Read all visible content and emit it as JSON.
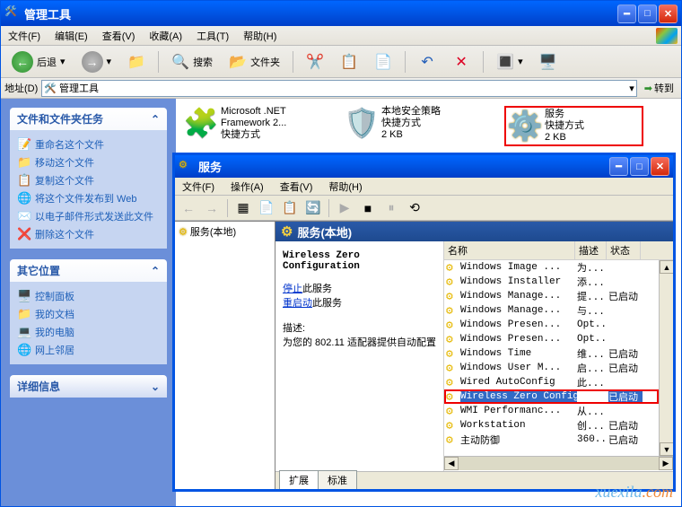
{
  "parent": {
    "title": "管理工具",
    "menus": [
      "文件(F)",
      "编辑(E)",
      "查看(V)",
      "收藏(A)",
      "工具(T)",
      "帮助(H)"
    ],
    "back": "后退",
    "search": "搜索",
    "folders": "文件夹",
    "addr_label": "地址(D)",
    "addr_value": "管理工具",
    "go": "转到"
  },
  "tasks": {
    "g1": {
      "title": "文件和文件夹任务"
    },
    "links1": [
      "重命名这个文件",
      "移动这个文件",
      "复制这个文件",
      "将这个文件发布到 Web",
      "以电子邮件形式发送此文件",
      "删除这个文件"
    ],
    "g2": {
      "title": "其它位置"
    },
    "links2": [
      "控制面板",
      "我的文档",
      "我的电脑",
      "网上邻居"
    ],
    "g3": {
      "title": "详细信息"
    }
  },
  "items": [
    {
      "name": "Microsoft .NET",
      "line2": "Framework 2...",
      "line3": "快捷方式"
    },
    {
      "name": "本地安全策略",
      "line2": "快捷方式",
      "line3": "2 KB"
    },
    {
      "name": "服务",
      "line2": "快捷方式",
      "line3": "2 KB"
    }
  ],
  "services": {
    "title": "服务",
    "menus": [
      "文件(F)",
      "操作(A)",
      "查看(V)",
      "帮助(H)"
    ],
    "tree_label": "服务(本地)",
    "header": "服务(本地)",
    "sel_name": "Wireless Zero Configuration",
    "stop": "停止",
    "stop_suffix": "此服务",
    "restart": "重启动",
    "restart_suffix": "此服务",
    "desc_label": "描述:",
    "desc_text": "为您的 802.11 适配器提供自动配置",
    "cols": {
      "name": "名称",
      "desc": "描述",
      "status": "状态"
    },
    "rows": [
      {
        "n": "Windows Image ...",
        "d": "为...",
        "s": ""
      },
      {
        "n": "Windows Installer",
        "d": "添...",
        "s": ""
      },
      {
        "n": "Windows Manage...",
        "d": "提...",
        "s": "已启动"
      },
      {
        "n": "Windows Manage...",
        "d": "与...",
        "s": ""
      },
      {
        "n": "Windows Presen...",
        "d": "Opt...",
        "s": ""
      },
      {
        "n": "Windows Presen...",
        "d": "Opt...",
        "s": ""
      },
      {
        "n": "Windows Time",
        "d": "维...",
        "s": "已启动"
      },
      {
        "n": "Windows User M...",
        "d": "启...",
        "s": "已启动"
      },
      {
        "n": "Wired AutoConfig",
        "d": "此...",
        "s": ""
      },
      {
        "n": "Wireless Zero Configuration",
        "d": "",
        "s": "已启动",
        "sel": true
      },
      {
        "n": "WMI Performanc...",
        "d": "从...",
        "s": ""
      },
      {
        "n": "Workstation",
        "d": "创...",
        "s": "已启动"
      },
      {
        "n": "主动防御",
        "d": "360...",
        "s": "已启动"
      }
    ],
    "tabs": [
      "扩展",
      "标准"
    ]
  },
  "watermark": {
    "a": "xuexila",
    "b": ".com"
  }
}
